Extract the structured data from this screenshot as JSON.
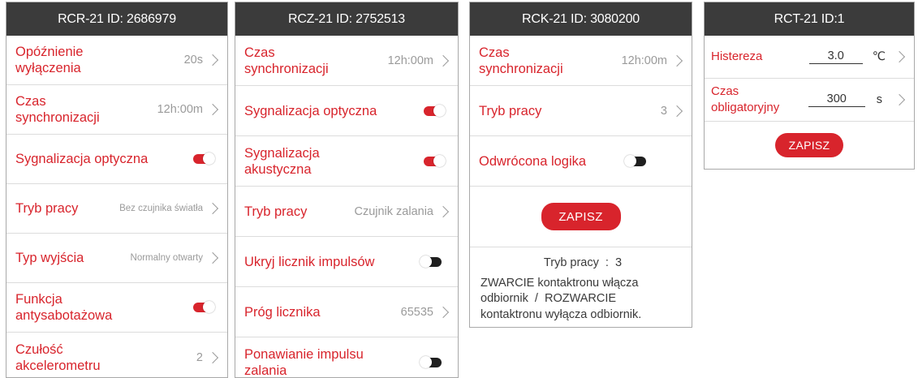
{
  "colors": {
    "accent": "#d8242c",
    "header_bg": "#3b3b3b",
    "muted": "#9a9a9a"
  },
  "rcr": {
    "title": "RCR-21 ID: 2686979",
    "rows": [
      {
        "label1": "Opóźnienie",
        "label2": "wyłączenia",
        "value": "20s"
      },
      {
        "label1": "Czas",
        "label2": "synchronizacji",
        "value": "12h:00m"
      },
      {
        "label1": "Sygnalizacja optyczna",
        "toggle": "on"
      },
      {
        "label1": "Tryb pracy",
        "value": "Bez czujnika światła"
      },
      {
        "label1": "Typ wyjścia",
        "value": "Normalny otwarty"
      },
      {
        "label1": "Funkcja",
        "label2": "antysabotażowa",
        "toggle": "on"
      },
      {
        "label1": "Czułość",
        "label2": "akcelerometru",
        "value": "2"
      }
    ]
  },
  "rcz": {
    "title": "RCZ-21 ID: 2752513",
    "rows": [
      {
        "label1": "Czas",
        "label2": "synchronizacji",
        "value": "12h:00m"
      },
      {
        "label1": "Sygnalizacja optyczna",
        "toggle": "on"
      },
      {
        "label1": "Sygnalizacja",
        "label2": "akustyczna",
        "toggle": "on"
      },
      {
        "label1": "Tryb pracy",
        "value": "Czujnik zalania"
      },
      {
        "label1": "Ukryj licznik impulsów",
        "toggle": "off"
      },
      {
        "label1": "Próg licznika",
        "value": "65535"
      },
      {
        "label1": "Ponawianie impulsu",
        "label2": "zalania",
        "toggle": "off"
      }
    ]
  },
  "rck": {
    "title": "RCK-21 ID: 3080200",
    "rows": [
      {
        "label1": "Czas",
        "label2": "synchronizacji",
        "value": "12h:00m"
      },
      {
        "label1": "Tryb pracy",
        "value": "3"
      },
      {
        "label1": "Odwrócona logika",
        "toggle": "off"
      }
    ],
    "save_label": "ZAPISZ",
    "info_title": "Tryb pracy  :  3",
    "info_line1": "ZWARCIE kontaktronu włącza",
    "info_line2": "odbiornik  /  ROZWARCIE",
    "info_line3": "kontaktronu wyłącza odbiornik."
  },
  "rct": {
    "title": "RCT-21 ID:1",
    "hysteresis_label": "Histereza",
    "hysteresis_value": "3.0",
    "hysteresis_unit": "℃",
    "time_label": "Czas obligatoryjny",
    "time_value": "300",
    "time_unit": "s",
    "save_label": "ZAPISZ"
  }
}
